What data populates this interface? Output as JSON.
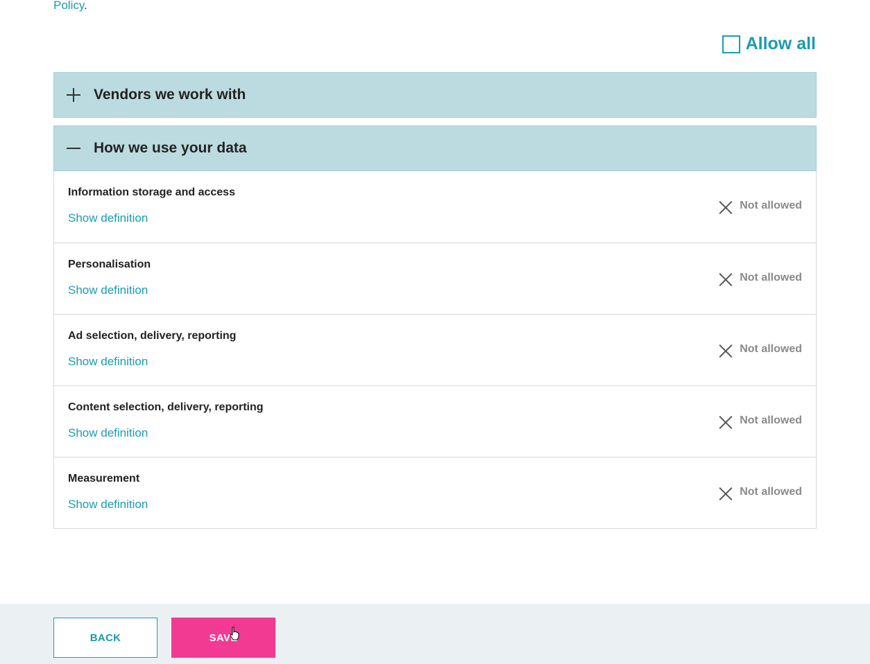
{
  "intro": {
    "policy_link": "Policy",
    "policy_punct": "."
  },
  "allow_all": {
    "label": "Allow all",
    "checked": false
  },
  "sections": [
    {
      "title": "Vendors we work with",
      "icon": "plus-icon",
      "expanded": false
    },
    {
      "title": "How we use your data",
      "icon": "minus-icon",
      "expanded": true
    }
  ],
  "purposes": [
    {
      "name": "Information storage and access",
      "definition_link": "Show definition",
      "status": "Not allowed"
    },
    {
      "name": "Personalisation",
      "definition_link": "Show definition",
      "status": "Not allowed"
    },
    {
      "name": "Ad selection, delivery, reporting",
      "definition_link": "Show definition",
      "status": "Not allowed"
    },
    {
      "name": "Content selection, delivery, reporting",
      "definition_link": "Show definition",
      "status": "Not allowed"
    },
    {
      "name": "Measurement",
      "definition_link": "Show definition",
      "status": "Not allowed"
    }
  ],
  "footer": {
    "back_label": "BACK",
    "save_label": "SAVE"
  },
  "colors": {
    "accent": "#1a9bb0",
    "save": "#f23a92",
    "accordion_bg": "#bcdbe0",
    "footer_bg": "#ebf1f3"
  }
}
